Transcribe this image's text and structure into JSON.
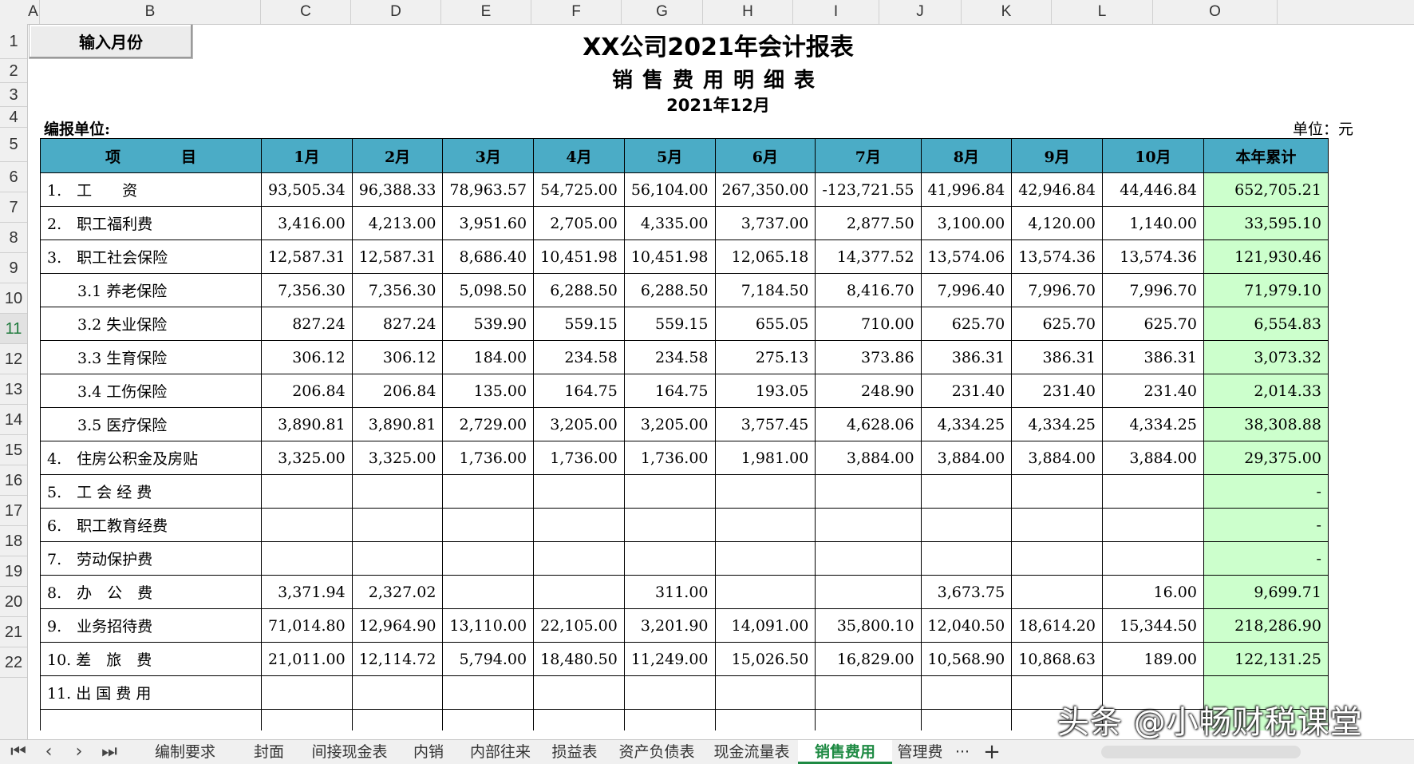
{
  "columns": [
    "A",
    "B",
    "C",
    "D",
    "E",
    "F",
    "G",
    "H",
    "I",
    "J",
    "K",
    "L",
    "O"
  ],
  "rows": [
    "1",
    "2",
    "3",
    "4",
    "5",
    "6",
    "7",
    "8",
    "9",
    "10",
    "11",
    "12",
    "13",
    "14",
    "15",
    "16",
    "17",
    "18",
    "19",
    "20",
    "21",
    "22"
  ],
  "active_row": "11",
  "button_label": "输入月份",
  "title": "XX公司2021年会计报表",
  "subtitle": "销售费用明细表",
  "period": "2021年12月",
  "unit_left": "编报单位:",
  "unit_right": "单位：元",
  "header": [
    "项　　　　目",
    "1月",
    "2月",
    "3月",
    "4月",
    "5月",
    "6月",
    "7月",
    "8月",
    "9月",
    "10月",
    "本年累计"
  ],
  "table": [
    {
      "item": "1.　工　　资",
      "values": [
        "93,505.34",
        "96,388.33",
        "78,963.57",
        "54,725.00",
        "56,104.00",
        "267,350.00",
        "-123,721.55",
        "41,996.84",
        "42,946.84",
        "44,446.84"
      ],
      "total": "652,705.21"
    },
    {
      "item": "2.　职工福利费",
      "values": [
        "3,416.00",
        "4,213.00",
        "3,951.60",
        "2,705.00",
        "4,335.00",
        "3,737.00",
        "2,877.50",
        "3,100.00",
        "4,120.00",
        "1,140.00"
      ],
      "total": "33,595.10"
    },
    {
      "item": "3.　职工社会保险",
      "values": [
        "12,587.31",
        "12,587.31",
        "8,686.40",
        "10,451.98",
        "10,451.98",
        "12,065.18",
        "14,377.52",
        "13,574.06",
        "13,574.36",
        "13,574.36"
      ],
      "total": "121,930.46"
    },
    {
      "item": "　　3.1 养老保险",
      "values": [
        "7,356.30",
        "7,356.30",
        "5,098.50",
        "6,288.50",
        "6,288.50",
        "7,184.50",
        "8,416.70",
        "7,996.40",
        "7,996.70",
        "7,996.70"
      ],
      "total": "71,979.10"
    },
    {
      "item": "　　3.2 失业保险",
      "values": [
        "827.24",
        "827.24",
        "539.90",
        "559.15",
        "559.15",
        "655.05",
        "710.00",
        "625.70",
        "625.70",
        "625.70"
      ],
      "total": "6,554.83"
    },
    {
      "item": "　　3.3 生育保险",
      "values": [
        "306.12",
        "306.12",
        "184.00",
        "234.58",
        "234.58",
        "275.13",
        "373.86",
        "386.31",
        "386.31",
        "386.31"
      ],
      "total": "3,073.32"
    },
    {
      "item": "　　3.4 工伤保险",
      "values": [
        "206.84",
        "206.84",
        "135.00",
        "164.75",
        "164.75",
        "193.05",
        "248.90",
        "231.40",
        "231.40",
        "231.40"
      ],
      "total": "2,014.33"
    },
    {
      "item": "　　3.5 医疗保险",
      "values": [
        "3,890.81",
        "3,890.81",
        "2,729.00",
        "3,205.00",
        "3,205.00",
        "3,757.45",
        "4,628.06",
        "4,334.25",
        "4,334.25",
        "4,334.25"
      ],
      "total": "38,308.88"
    },
    {
      "item": "4.　住房公积金及房贴",
      "values": [
        "3,325.00",
        "3,325.00",
        "1,736.00",
        "1,736.00",
        "1,736.00",
        "1,981.00",
        "3,884.00",
        "3,884.00",
        "3,884.00",
        "3,884.00"
      ],
      "total": "29,375.00"
    },
    {
      "item": "5.　工 会 经 费",
      "values": [
        "",
        "",
        "",
        "",
        "",
        "",
        "",
        "",
        "",
        ""
      ],
      "total": "-"
    },
    {
      "item": "6.　职工教育经费",
      "values": [
        "",
        "",
        "",
        "",
        "",
        "",
        "",
        "",
        "",
        ""
      ],
      "total": "-"
    },
    {
      "item": "7.　劳动保护费",
      "values": [
        "",
        "",
        "",
        "",
        "",
        "",
        "",
        "",
        "",
        ""
      ],
      "total": "-"
    },
    {
      "item": "8.　办　公　费",
      "values": [
        "3,371.94",
        "2,327.02",
        "",
        "",
        "311.00",
        "",
        "",
        "3,673.75",
        "",
        "16.00"
      ],
      "total": "9,699.71"
    },
    {
      "item": "9.　业务招待费",
      "values": [
        "71,014.80",
        "12,964.90",
        "13,110.00",
        "22,105.00",
        "3,201.90",
        "14,091.00",
        "35,800.10",
        "12,040.50",
        "18,614.20",
        "15,344.50"
      ],
      "total": "218,286.90"
    },
    {
      "item": "10. 差　旅　费",
      "values": [
        "21,011.00",
        "12,114.72",
        "5,794.00",
        "18,480.50",
        "11,249.00",
        "15,026.50",
        "16,829.00",
        "10,568.90",
        "10,868.63",
        "189.00"
      ],
      "total": "122,131.25"
    },
    {
      "item": "11. 出 国 费 用",
      "values": [
        "",
        "",
        "",
        "",
        "",
        "",
        "",
        "",
        "",
        ""
      ],
      "total": ""
    }
  ],
  "nav_icons": [
    "first-sheet-icon",
    "prev-sheet-icon",
    "next-sheet-icon",
    "last-sheet-icon"
  ],
  "nav_glyphs": [
    "⏮",
    "‹",
    "›",
    "⏭"
  ],
  "tabs": [
    "编制要求",
    "封面",
    "间接现金表",
    "内销",
    "内部往来",
    "损益表",
    "资产负债表",
    "现金流量表",
    "销售费用",
    "管理费"
  ],
  "active_tab": "销售费用",
  "more_tabs": "···",
  "add_sheet": "+",
  "watermark": "头条 @小畅财税课堂",
  "colors": {
    "header_fill": "#4bacc6",
    "total_fill": "#ccffcc",
    "active_tab": "#1e8a43"
  }
}
